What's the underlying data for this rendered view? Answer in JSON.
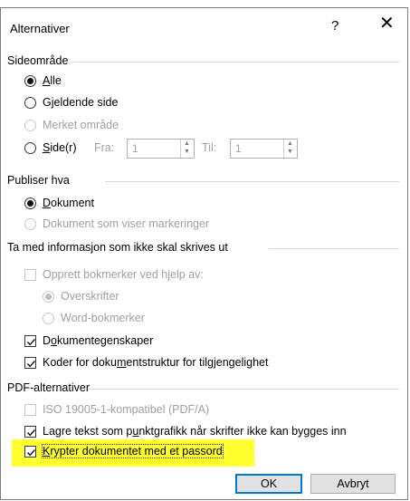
{
  "dialog": {
    "title": "Alternativer",
    "help_glyph": "?",
    "close_glyph": "✕"
  },
  "page_range": {
    "legend": "Sideområde",
    "all": "Alle",
    "current_page": "Gjeldende side",
    "selection": "Merket område",
    "pages": "Side(r)",
    "from_label": "Fra:",
    "from_value": "1",
    "to_label": "Til:",
    "to_value": "1",
    "selected": "all"
  },
  "publish": {
    "legend": "Publiser hva",
    "document": "Dokument",
    "document_markup": "Dokument som viser markeringer",
    "selected": "document"
  },
  "nonprint": {
    "legend": "Ta med informasjon som ikke skal skrives ut",
    "bookmarks": "Opprett bokmerker ved hjelp av:",
    "headings": "Overskrifter",
    "word_bookmarks": "Word-bokmerker",
    "doc_properties": "Dokumentegenskaper",
    "structure_tags": "Koder for dokumentstruktur for tilgjengelighet",
    "bookmarks_checked": false,
    "doc_properties_checked": true,
    "structure_tags_checked": true
  },
  "pdf": {
    "legend": "PDF-alternativer",
    "iso": "ISO 19005-1-kompatibel (PDF/A)",
    "bitmap": "Lagre tekst som punktgrafikk når skrifter ikke kan bygges inn",
    "encrypt": "Krypter dokumentet med et passord",
    "iso_checked": false,
    "bitmap_checked": true,
    "encrypt_checked": true,
    "highlight_color": "#ffff2e"
  },
  "buttons": {
    "ok": "OK",
    "cancel": "Avbryt"
  }
}
